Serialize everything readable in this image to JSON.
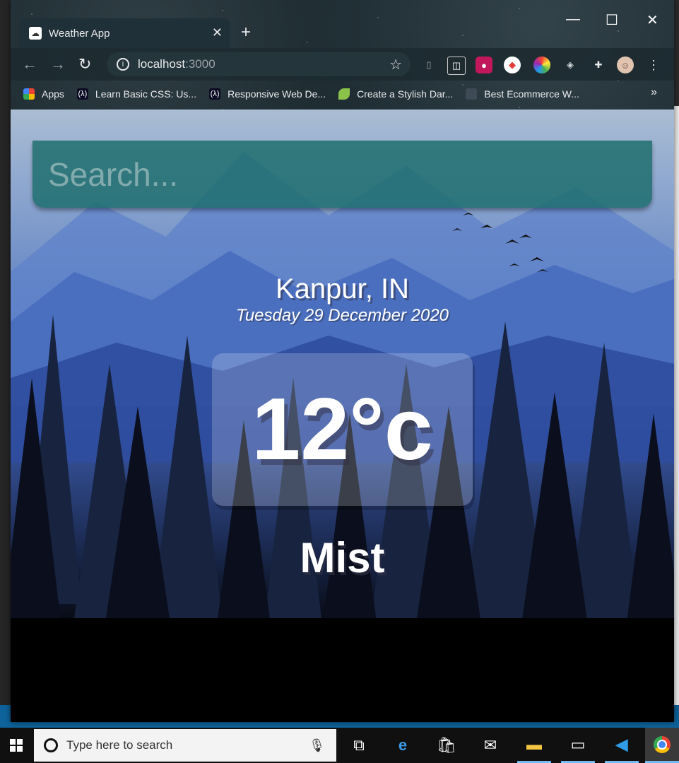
{
  "browser": {
    "tab_title": "Weather App",
    "tab_close": "✕",
    "new_tab": "+",
    "url_host": "localhost",
    "url_port": ":3000",
    "window_controls": [
      "—",
      "☐",
      "✕"
    ],
    "bookmarks": [
      {
        "label": "Apps",
        "icon": "apps-grid-icon"
      },
      {
        "label": "Learn Basic CSS: Us...",
        "icon": "fcc-icon"
      },
      {
        "label": "Responsive Web De...",
        "icon": "fcc-icon"
      },
      {
        "label": "Create a Stylish Dar...",
        "icon": "leaf-icon"
      },
      {
        "label": "Best Ecommerce W...",
        "icon": "site-icon"
      }
    ],
    "bookmarks_overflow": "»"
  },
  "app": {
    "search_placeholder": "Search...",
    "location": "Kanpur, IN",
    "date": "Tuesday 29 December 2020",
    "temperature": "12°c",
    "weather": "Mist"
  },
  "taskbar": {
    "search_placeholder": "Type here to search"
  },
  "colors": {
    "search_bar": "#1e6e6e",
    "accent": "#0e639c"
  }
}
